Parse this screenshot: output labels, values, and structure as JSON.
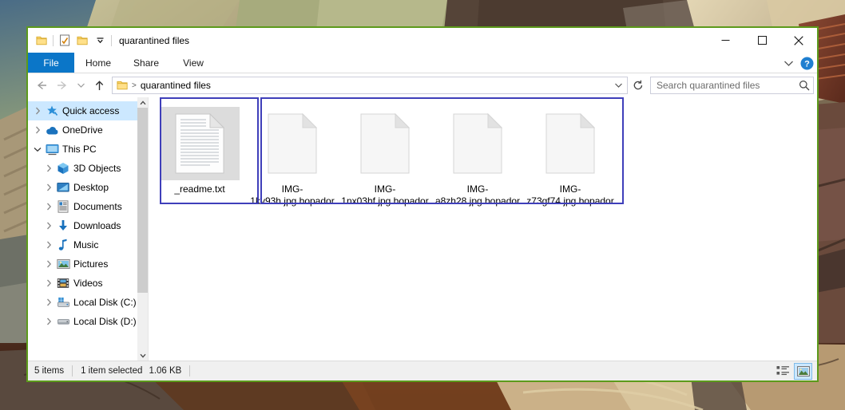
{
  "window": {
    "title": "quarantined files",
    "quick_access_icons": [
      "folder-icon",
      "properties-icon",
      "new-folder-icon",
      "chevron-down-icon"
    ],
    "controls": {
      "minimize": "minimize-icon",
      "maximize": "maximize-icon",
      "close": "close-icon"
    }
  },
  "ribbon": {
    "tabs": [
      {
        "label": "File",
        "active": true
      },
      {
        "label": "Home",
        "active": false
      },
      {
        "label": "Share",
        "active": false
      },
      {
        "label": "View",
        "active": false
      }
    ],
    "expand_icon": "chevron-down-icon",
    "help_icon": "help-icon"
  },
  "address": {
    "back_icon": "arrow-left-icon",
    "forward_icon": "arrow-right-icon",
    "recent_icon": "chevron-down-icon",
    "up_icon": "arrow-up-icon",
    "crumb_separator": ">",
    "path": "quarantined files",
    "dropdown_icon": "chevron-down-icon",
    "refresh_icon": "refresh-icon"
  },
  "search": {
    "placeholder": "Search quarantined files",
    "icon": "search-icon"
  },
  "sidebar": {
    "items": [
      {
        "label": "Quick access",
        "icon": "pin-star-icon",
        "depth": 0,
        "expandable": true,
        "expanded": false,
        "selected": true
      },
      {
        "label": "OneDrive",
        "icon": "cloud-icon",
        "depth": 0,
        "expandable": true,
        "expanded": false,
        "selected": false
      },
      {
        "label": "This PC",
        "icon": "monitor-icon",
        "depth": 0,
        "expandable": true,
        "expanded": true,
        "selected": false
      },
      {
        "label": "3D Objects",
        "icon": "cube-icon",
        "depth": 1,
        "expandable": true,
        "expanded": false,
        "selected": false
      },
      {
        "label": "Desktop",
        "icon": "desktop-icon",
        "depth": 1,
        "expandable": true,
        "expanded": false,
        "selected": false
      },
      {
        "label": "Documents",
        "icon": "documents-icon",
        "depth": 1,
        "expandable": true,
        "expanded": false,
        "selected": false
      },
      {
        "label": "Downloads",
        "icon": "download-arrow-icon",
        "depth": 1,
        "expandable": true,
        "expanded": false,
        "selected": false
      },
      {
        "label": "Music",
        "icon": "music-note-icon",
        "depth": 1,
        "expandable": true,
        "expanded": false,
        "selected": false
      },
      {
        "label": "Pictures",
        "icon": "picture-icon",
        "depth": 1,
        "expandable": true,
        "expanded": false,
        "selected": false
      },
      {
        "label": "Videos",
        "icon": "film-icon",
        "depth": 1,
        "expandable": true,
        "expanded": false,
        "selected": false
      },
      {
        "label": "Local Disk (C:)",
        "icon": "system-drive-icon",
        "depth": 1,
        "expandable": true,
        "expanded": false,
        "selected": false
      },
      {
        "label": "Local Disk (D:)",
        "icon": "drive-icon",
        "depth": 1,
        "expandable": true,
        "expanded": false,
        "selected": false
      }
    ],
    "scrollbar": {
      "up_icon": "chevron-up-icon",
      "down_icon": "chevron-down-icon"
    }
  },
  "files": [
    {
      "name": "_readme.txt",
      "icon": "text-file-icon",
      "selected": true
    },
    {
      "name": "IMG-1kv93h.jpg.bopador",
      "icon": "blank-file-icon",
      "selected": false
    },
    {
      "name": "IMG-1nx03hf.jpg.bopador",
      "icon": "blank-file-icon",
      "selected": false
    },
    {
      "name": "IMG-a8zh28.jpg.bopador",
      "icon": "blank-file-icon",
      "selected": false
    },
    {
      "name": "IMG-z73gf74.jpg.bopador",
      "icon": "blank-file-icon",
      "selected": false
    }
  ],
  "statusbar": {
    "item_count": "5 items",
    "selection": "1 item selected",
    "size": "1.06 KB",
    "details_view_icon": "details-view-icon",
    "large_icons_view_icon": "large-icons-view-icon"
  },
  "colors": {
    "window_border": "#5c9a1b",
    "file_tab": "#0b76c8",
    "selection": "#cce8ff",
    "annotation": "#3f3fba",
    "folder": "#fcd670"
  }
}
